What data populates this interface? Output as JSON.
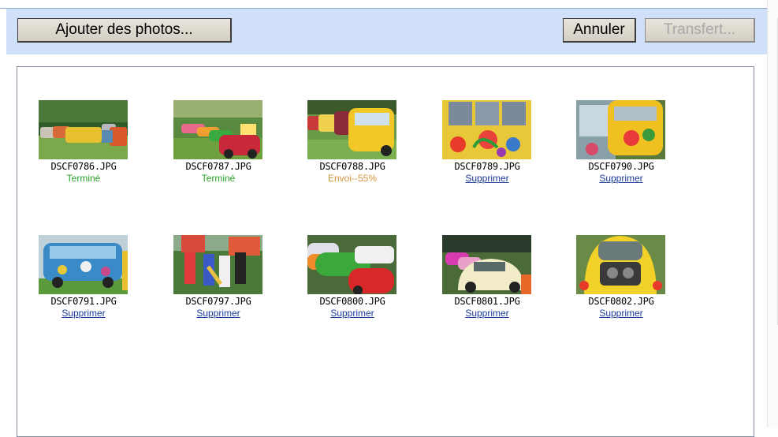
{
  "toolbar": {
    "add_label": "Ajouter des photos...",
    "cancel_label": "Annuler",
    "transfer_label": "Transfert..."
  },
  "photos": [
    {
      "name": "DSCF0786.JPG",
      "status": "Terminé",
      "state": "done"
    },
    {
      "name": "DSCF0787.JPG",
      "status": "Terminé",
      "state": "done"
    },
    {
      "name": "DSCF0788.JPG",
      "status": "Envoi--55%",
      "state": "sending",
      "progress": 55
    },
    {
      "name": "DSCF0789.JPG",
      "status": "Supprimer",
      "state": "del"
    },
    {
      "name": "DSCF0790.JPG",
      "status": "Supprimer",
      "state": "del"
    },
    {
      "name": "DSCF0791.JPG",
      "status": "Supprimer",
      "state": "del"
    },
    {
      "name": "DSCF0797.JPG",
      "status": "Supprimer",
      "state": "del"
    },
    {
      "name": "DSCF0800.JPG",
      "status": "Supprimer",
      "state": "del"
    },
    {
      "name": "DSCF0801.JPG",
      "status": "Supprimer",
      "state": "del"
    },
    {
      "name": "DSCF0802.JPG",
      "status": "Supprimer",
      "state": "del"
    }
  ],
  "colors": {
    "header_bg": "#cfe0f8",
    "done": "#2aa02a",
    "sending": "#d89540",
    "link": "#1a3a9a"
  }
}
